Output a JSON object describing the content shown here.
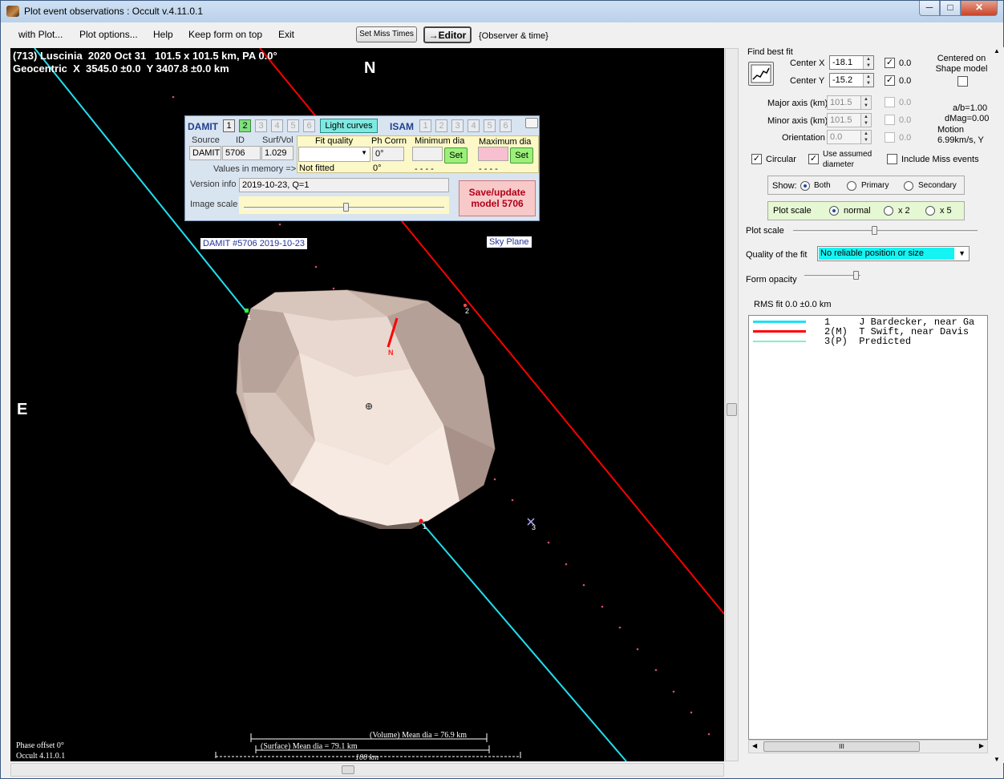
{
  "window": {
    "title": "Plot event observations : Occult v.4.11.0.1"
  },
  "menu": {
    "items": [
      "with Plot...",
      "Plot options...",
      "Help",
      "Keep form on top",
      "Exit"
    ],
    "set_miss_times": "Set Miss Times",
    "editor": "→Editor",
    "observer_time": "{Observer & time}"
  },
  "plot": {
    "header_line1": "(713) Luscinia  2020 Oct 31   101.5 x 101.5 km, PA 0.0°",
    "header_line2": "Geocentric  X  3545.0 ±0.0  Y 3407.8 ±0.0 km",
    "north": "N",
    "east": "E",
    "damit_label": "DAMIT #5706 2019-10-23",
    "sky_plane": "Sky Plane",
    "pole_label": "N",
    "chord_labels": [
      "1",
      "2",
      "1",
      "3"
    ],
    "phase_offset": "Phase offset 0°",
    "version": "Occult 4.11.0.1",
    "volume_dia": "(Volume) Mean dia = 76.9 km",
    "surface_dia": "(Surface) Mean dia = 79.1 km",
    "scale_bar": "100 km"
  },
  "damit_panel": {
    "damit": "DAMIT",
    "isam": "ISAM",
    "damit_buttons": [
      "1",
      "2",
      "3",
      "4",
      "5",
      "6"
    ],
    "isam_buttons": [
      "1",
      "2",
      "3",
      "4",
      "5",
      "6"
    ],
    "light_curves": "Light curves",
    "source_label": "Source",
    "id_label": "ID",
    "surfvol_label": "Surf/Vol",
    "source": "DAMIT",
    "id": "5706",
    "surfvol": "1.029",
    "values_in_memory": "Values in memory =>",
    "fit_quality_label": "Fit quality",
    "ph_corrn_label": "Ph Corrn",
    "min_dia_label": "Minimum dia",
    "max_dia_label": "Maximum dia",
    "ph_corrn_value": "0°",
    "set": "Set",
    "not_fitted": "Not fitted",
    "ph_memory": "0°",
    "min_memory": "- - - -",
    "max_memory": "- - - -",
    "version_info_label": "Version info",
    "version_info": "2019-10-23, Q=1",
    "image_scale_label": "Image scale",
    "save_update": "Save/update model 5706"
  },
  "right_panel": {
    "find_best_fit": "Find best fit",
    "center_x_label": "Center X",
    "center_x": "-18.1",
    "center_y_label": "Center Y",
    "center_y": "-15.2",
    "center_x_unc": "0.0",
    "center_y_unc": "0.0",
    "centered_on": "Centered on Shape model",
    "major_label": "Major axis (km)",
    "major": "101.5",
    "major_unc": "0.0",
    "minor_label": "Minor axis (km)",
    "minor": "101.5",
    "minor_unc": "0.0",
    "orient_label": "Orientation",
    "orient": "0.0",
    "orient_unc": "0.0",
    "ab": "a/b=1.00",
    "dmag": "dMag=0.00",
    "motion": "Motion",
    "motion_value": "6.99km/s, Y",
    "circular": "Circular",
    "use_assumed": "Use assumed diameter",
    "include_miss": "Include Miss events",
    "show_label": "Show:",
    "show_both": "Both",
    "show_primary": "Primary",
    "show_secondary": "Secondary",
    "plot_scale_label": "Plot scale",
    "scale_normal": "normal",
    "scale_x2": "x 2",
    "scale_x5": "x 5",
    "plot_scale_slider": "Plot scale",
    "quality_label": "Quality of the fit",
    "quality_value": "No reliable position or size",
    "form_opacity": "Form opacity",
    "rms_fit": "RMS fit 0.0 ±0.0 km",
    "legend": [
      {
        "num": "1",
        "flag": "",
        "name": "J Bardecker, near Ga",
        "color": "#20e0f0"
      },
      {
        "num": "2",
        "flag": "(M)",
        "name": "T Swift, near Davis",
        "color": "#ff0000"
      },
      {
        "num": "3",
        "flag": "(P)",
        "name": "Predicted",
        "color": "#7ff0c8"
      }
    ],
    "hscroll_mid": "III"
  }
}
